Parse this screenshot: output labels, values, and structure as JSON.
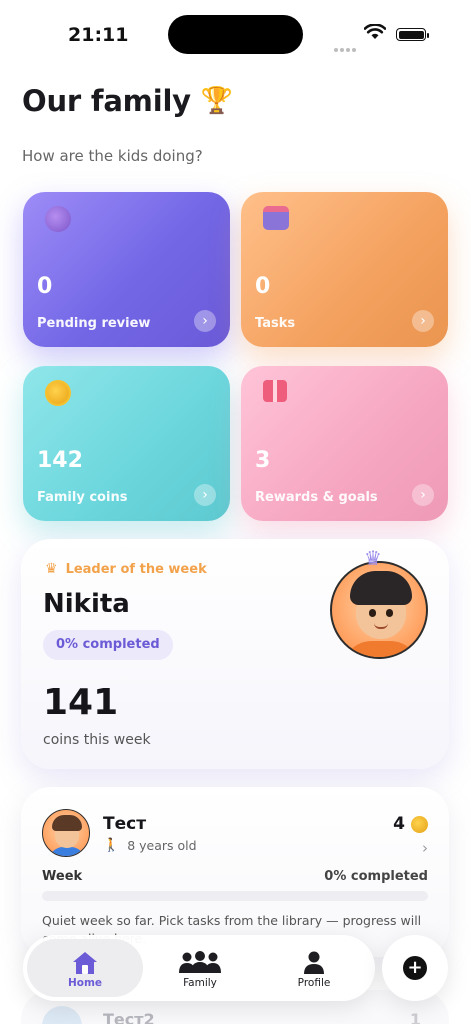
{
  "status_bar": {
    "time": "21:11"
  },
  "header": {
    "title": "Our family",
    "title_emoji": "🏆",
    "subtitle": "How are the kids doing?"
  },
  "tiles": [
    {
      "value": "0",
      "label": "Pending review",
      "icon": "gear-badge-icon",
      "arrow": "›"
    },
    {
      "value": "0",
      "label": "Tasks",
      "icon": "calendar-icon",
      "arrow": "›"
    },
    {
      "value": "142",
      "label": "Family coins",
      "icon": "coin-icon",
      "arrow": "›"
    },
    {
      "value": "3",
      "label": "Rewards & goals",
      "icon": "gift-icon",
      "arrow": "›"
    }
  ],
  "leader": {
    "tag": "Leader of the week",
    "name": "Nikita",
    "progress": "0% completed",
    "coins": "141",
    "coins_label": "coins this week"
  },
  "children": [
    {
      "name": "Тест",
      "age": "8 years old",
      "coins": "4",
      "week_label": "Week",
      "week_pct": "0% completed",
      "progress_fraction": 0,
      "note": "Quiet week so far. Pick tasks from the library — progress will come alive here."
    },
    {
      "name": "Тест2",
      "coins": "1"
    }
  ],
  "tab_bar": {
    "tabs": [
      {
        "label": "Home",
        "icon": "home-icon",
        "active": true
      },
      {
        "label": "Family",
        "icon": "family-icon",
        "active": false
      },
      {
        "label": "Profile",
        "icon": "profile-icon",
        "active": false
      }
    ],
    "fab_icon": "plus-icon"
  },
  "colors": {
    "accent": "#6b5bd6",
    "pending_tile": "#7367e6",
    "tasks_tile": "#f4a15f",
    "coins_tile": "#6ad6dc",
    "rewards_tile": "#f6a6c1",
    "leader_tag": "#f2a24a"
  }
}
